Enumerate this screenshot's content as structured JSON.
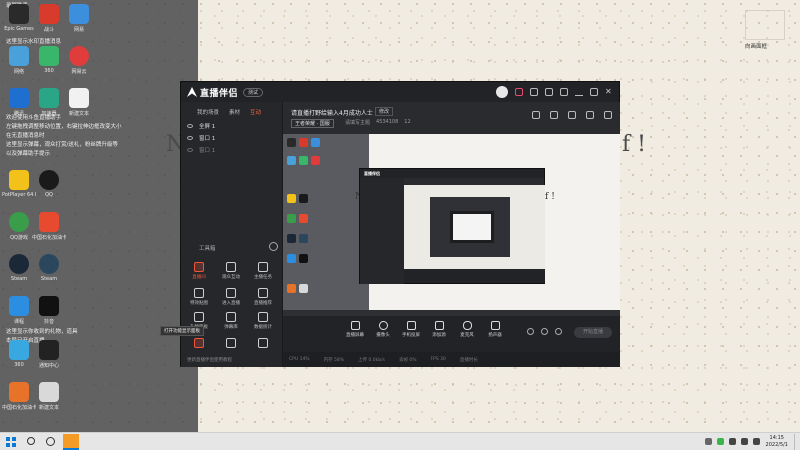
{
  "desktop": {
    "top_caption": "录屏助手",
    "top_right_label": "向画面框",
    "background_text_left": "N",
    "background_text_right": "f !",
    "icons": [
      {
        "label": "Epic Games",
        "icon": "epic-icon"
      },
      {
        "label": "战斗",
        "icon": "game-icon"
      },
      {
        "label": "网易",
        "icon": "netease-icon"
      },
      {
        "label": "网络",
        "icon": "network-icon"
      },
      {
        "label": "360",
        "icon": "app-icon"
      },
      {
        "label": "网易云",
        "icon": "music-icon"
      },
      {
        "label": "腾讯",
        "icon": "tencent-icon"
      },
      {
        "label": "加速器",
        "icon": "boost-icon"
      },
      {
        "label": "新建文本",
        "icon": "file-icon"
      },
      {
        "label": "PotPlayer 64 bit",
        "icon": "potplayer-icon"
      },
      {
        "label": "QQ",
        "icon": "qq-icon"
      },
      {
        "label": "QQ游戏",
        "icon": "qq-game-icon"
      },
      {
        "label": "Steam",
        "icon": "steam-icon"
      },
      {
        "label": "Steam",
        "icon": "steam2-icon"
      },
      {
        "label": "课程",
        "icon": "course-icon"
      },
      {
        "label": "抖音",
        "icon": "tiktok-icon"
      },
      {
        "label": "360",
        "icon": "browser-icon"
      },
      {
        "label": "通知中心",
        "icon": "notify-icon"
      },
      {
        "label": "中国石化加油卡",
        "icon": "card-icon"
      }
    ],
    "notes_top": [
      "这里显示水印直播消息",
      "欢迎使用斗鱼直播助手",
      "左键拖拽调整移动位置，右键拉伸边框改变大小",
      "在无直播消息时",
      "这里显示弹幕，观众打赏/送礼，粉丝牌升级等",
      "以及弹幕助手提示"
    ],
    "notes_bottom": [
      "这里显示你收到的礼物，道具",
      "本局已开启直播"
    ]
  },
  "app": {
    "name": "直播伴侣",
    "version": "测试",
    "left_tabs": [
      {
        "label": "我的场景"
      },
      {
        "label": "素材"
      },
      {
        "label": "互动",
        "active": true
      }
    ],
    "scenes": [
      "全屏 1",
      "窗口 1",
      "窗口 1"
    ],
    "tools_label": "工具箱",
    "tools": [
      {
        "label": "直播间",
        "icon": "live-room-icon",
        "active": true
      },
      {
        "label": "观众互动",
        "icon": "audience-icon"
      },
      {
        "label": "主播任务",
        "icon": "task-icon"
      },
      {
        "label": "特效贴图",
        "icon": "sticker-icon"
      },
      {
        "label": "进入直播",
        "icon": "enter-icon"
      },
      {
        "label": "直播推荐",
        "icon": "recommend-icon"
      },
      {
        "label": "礼物面板",
        "icon": "gift-icon"
      },
      {
        "label": "弹幕库",
        "icon": "danmaku-icon"
      },
      {
        "label": "数据统计",
        "icon": "stats-icon"
      },
      {
        "label": "水印",
        "icon": "watermark-icon"
      },
      {
        "label": "连麦",
        "icon": "link-icon"
      },
      {
        "label": "场景",
        "icon": "scene-icon"
      }
    ],
    "left_footer": "更新直播伴侣使用教程",
    "tooltip": "打开功能显示面板",
    "room": {
      "title": "请直播打野给输入4月成功人士",
      "tag": "修改",
      "category": "王者荣耀 · 国服",
      "meta": [
        "请填写主题",
        "4534108",
        "12"
      ]
    },
    "preview_text_left": "N",
    "preview_text_right": "f !",
    "nested_title": "直播伴侣",
    "bottom_buttons": [
      {
        "label": "直播屏幕",
        "icon": "screen-icon"
      },
      {
        "label": "摄像头",
        "icon": "camera-icon"
      },
      {
        "label": "手机投屏",
        "icon": "phone-icon"
      },
      {
        "label": "添加源",
        "icon": "source-icon"
      },
      {
        "label": "麦克风",
        "icon": "mic-icon"
      },
      {
        "label": "扬声器",
        "icon": "speaker-icon"
      }
    ],
    "go_live_label": "开始直播",
    "status_items": [
      "CPU 14%",
      "内存 58%",
      "上传 0.0kb/s",
      "丢帧 0%",
      "FPS 30",
      "直播时长"
    ]
  },
  "taskbar": {
    "time": "14:15",
    "date": "2022/5/1"
  }
}
